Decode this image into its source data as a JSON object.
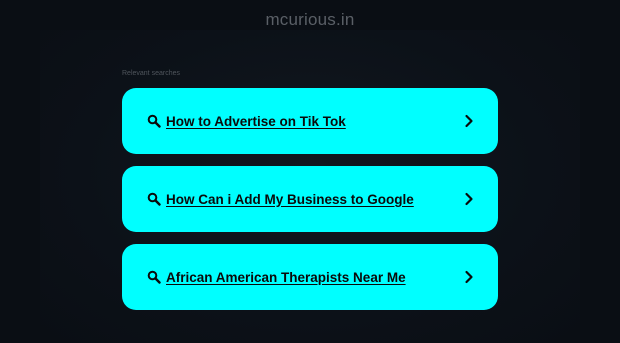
{
  "site": {
    "domain": "mcurious.in"
  },
  "relevant": {
    "label": "Relevant searches"
  },
  "results": [
    {
      "label": "How to Advertise on Tik Tok"
    },
    {
      "label": "How Can i Add My Business to Google"
    },
    {
      "label": "African American Therapists Near Me"
    }
  ],
  "colors": {
    "background": "#0a0e14",
    "card": "#00ffff",
    "card_text": "#0a0a0a",
    "title_text": "#5a5f66"
  },
  "icons": {
    "search": "search-icon",
    "chevron": "chevron-right-icon"
  }
}
